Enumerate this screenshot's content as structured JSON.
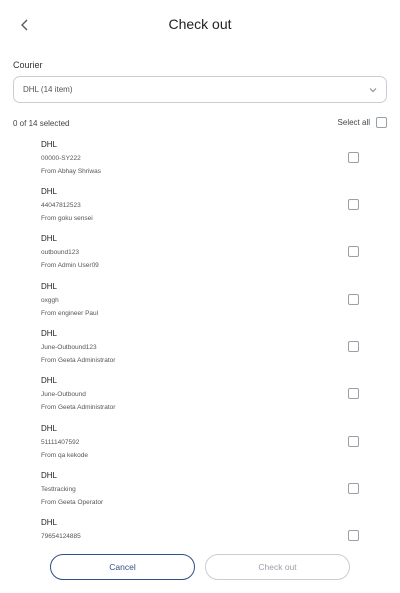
{
  "header": {
    "title": "Check out",
    "back_icon": "chevron-left-icon"
  },
  "courier": {
    "label": "Courier",
    "selected": "DHL (14 item)",
    "dropdown_icon": "chevron-down-icon"
  },
  "selection": {
    "count_text": "0 of 14 selected",
    "select_all_label": "Select all"
  },
  "items": [
    {
      "courier": "DHL",
      "tracking": "00000-SY222",
      "from": "From Abhay Shriwas",
      "checked": false
    },
    {
      "courier": "DHL",
      "tracking": "44047812523",
      "from": "From goku sensei",
      "checked": false
    },
    {
      "courier": "DHL",
      "tracking": "outbound123",
      "from": "From Admin User09",
      "checked": false
    },
    {
      "courier": "DHL",
      "tracking": "oxggh",
      "from": "From engineer Paul",
      "checked": false
    },
    {
      "courier": "DHL",
      "tracking": "June-Outbound123",
      "from": "From Geeta Administrator",
      "checked": false
    },
    {
      "courier": "DHL",
      "tracking": "June-Outbound",
      "from": "From Geeta Administrator",
      "checked": false
    },
    {
      "courier": "DHL",
      "tracking": "51111407592",
      "from": "From qa kekode",
      "checked": false
    },
    {
      "courier": "DHL",
      "tracking": "Testtracking",
      "from": "From Geeta Operator",
      "checked": false
    },
    {
      "courier": "DHL",
      "tracking": "79654124885",
      "from": "",
      "checked": false
    }
  ],
  "footer": {
    "cancel_label": "Cancel",
    "checkout_label": "Check out"
  },
  "colors": {
    "primary": "#2f4f86",
    "border": "#c9ced6",
    "disabled_text": "#9aa0a8"
  }
}
